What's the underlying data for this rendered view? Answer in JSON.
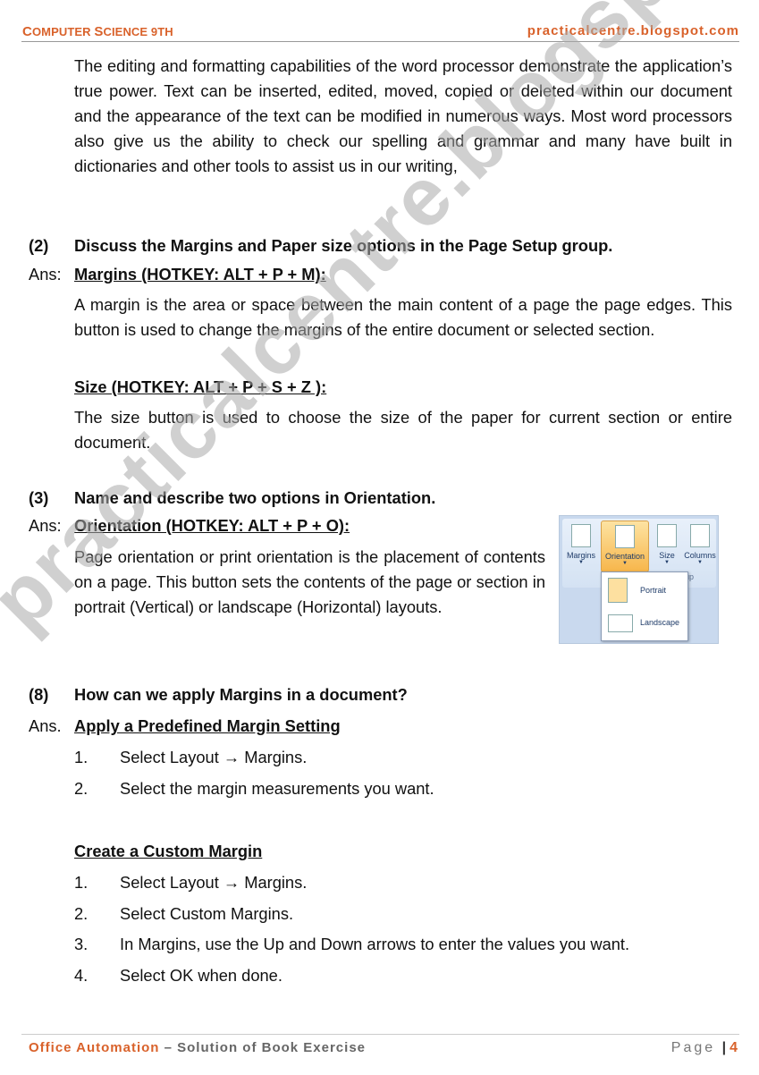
{
  "header": {
    "left_title": "Computer Science 9th",
    "left_c": "C",
    "left_omputer": "OMPUTER ",
    "left_s": "S",
    "left_cience": "CIENCE ",
    "left_9th": "9TH",
    "right_site": "practicalcentre.blogspot.com"
  },
  "watermark": "practicalcentre.blogspot.com",
  "intro_paragraph": "The editing and formatting capabilities of the word processor demonstrate the application’s true power. Text can be inserted, edited, moved, copied or deleted within our document and the appearance of the text can be modified in numerous ways. Most word processors also give us the ability to check our spelling and grammar and many have built in dictionaries and other tools to assist us in our writing,",
  "questions": [
    {
      "number": "(2)",
      "question": "Discuss the Margins and Paper size options in the Page Setup group.",
      "ans_label": "Ans:",
      "heading": "Margins (HOTKEY: ALT + P + M):",
      "heading_text": "A margin is the area or space between the main content of a page the page edges. This button is used to change the margins of the entire document or selected section.",
      "subheading": "Size (HOTKEY:  ALT + P + S + Z ):",
      "subheading_text": "The size button is used to choose the size of the paper for current section or entire document."
    },
    {
      "number": "(3)",
      "question": "Name and describe two options in Orientation.",
      "ans_label": "Ans:",
      "heading": "Orientation (HOTKEY:  ALT + P + O):",
      "heading_text": "Page orientation or print orientation is the placement of contents on a page. This button sets the contents of the page or section in portrait (Vertical) or landscape (Horizontal) layouts."
    },
    {
      "number": "(8)",
      "question": "How can we apply Margins in a document?",
      "ans_label": "Ans.",
      "heading": "Apply a Predefined Margin Setting",
      "steps": [
        {
          "num": "1.",
          "text": "Select Layout → Margins."
        },
        {
          "num": "2.",
          "text": "Select the margin measurements you want."
        }
      ],
      "subheading": "Create a Custom Margin",
      "sub_steps": [
        {
          "num": "1.",
          "text": "Select Layout → Margins."
        },
        {
          "num": "2.",
          "text": "Select Custom Margins."
        },
        {
          "num": "3.",
          "text": "In Margins, use the Up and Down arrows to enter the values you want."
        },
        {
          "num": "4.",
          "text": "Select OK when done."
        }
      ]
    }
  ],
  "ribbon_image": {
    "buttons": [
      "Margins",
      "Orientation",
      "Size",
      "Columns"
    ],
    "group_label_fragment": "up",
    "menu_items": [
      "Portrait",
      "Landscape"
    ]
  },
  "footer": {
    "left_accent": "Office Automation",
    "left_rest": " – Solution of Book Exercise",
    "page_label": "Page",
    "page_number": "4"
  }
}
